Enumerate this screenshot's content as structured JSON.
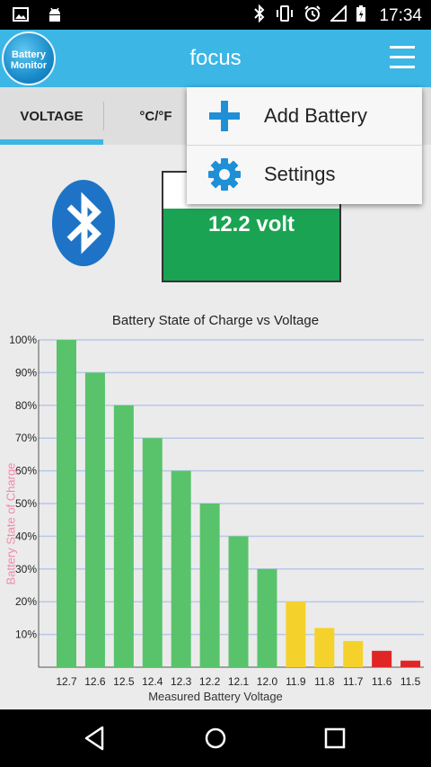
{
  "status_bar": {
    "time": "17:34",
    "icons_left": [
      "image-icon",
      "android-icon"
    ],
    "icons_right": [
      "bluetooth-icon",
      "vibrate-icon",
      "alarm-icon",
      "signal-icon",
      "battery-charging-icon"
    ]
  },
  "app_bar": {
    "logo_line1": "Battery",
    "logo_line2": "Monitor",
    "title": "focus",
    "accent_color": "#3cb6e5"
  },
  "tabs": [
    {
      "label": "VOLTAGE",
      "selected": true
    },
    {
      "label": "°C/°F",
      "selected": false
    }
  ],
  "voltage_reading": "12.2 volt",
  "popup_menu": {
    "items": [
      {
        "label": "Add Battery",
        "icon": "plus-icon"
      },
      {
        "label": "Settings",
        "icon": "gear-icon"
      }
    ]
  },
  "chart_data": {
    "type": "bar",
    "title": "Battery State of Charge vs Voltage",
    "xlabel": "Measured Battery Voltage",
    "ylabel": "Battery State of Charge",
    "categories": [
      "12.7",
      "12.6",
      "12.5",
      "12.4",
      "12.3",
      "12.2",
      "12.1",
      "12.0",
      "11.9",
      "11.8",
      "11.7",
      "11.6",
      "11.5"
    ],
    "values": [
      100,
      90,
      80,
      70,
      60,
      50,
      40,
      30,
      20,
      12,
      8,
      5,
      2
    ],
    "bar_colors": [
      "green",
      "green",
      "green",
      "green",
      "green",
      "green",
      "green",
      "green",
      "yellow",
      "yellow",
      "yellow",
      "red",
      "red"
    ],
    "y_ticks": [
      "10%",
      "20%",
      "30%",
      "40%",
      "50%",
      "60%",
      "70%",
      "80%",
      "90%",
      "100%"
    ],
    "ylim": [
      0,
      100
    ],
    "grid": true,
    "colors": {
      "green": "#58c36a",
      "yellow": "#f5d22b",
      "red": "#e02525",
      "grid": "#b8c8e8",
      "ylabel": "#f08aa8"
    }
  },
  "nav_bar": {
    "buttons": [
      "back-icon",
      "home-icon",
      "recents-icon"
    ]
  }
}
